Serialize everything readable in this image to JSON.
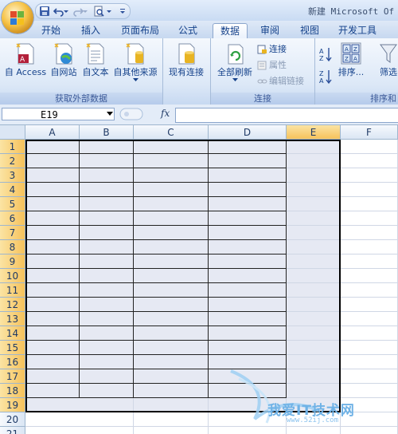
{
  "window": {
    "title": "新建 Microsoft Of",
    "watermark_text": "我爱IT技术网",
    "watermark_url": "www.52ij.com"
  },
  "tabs": [
    {
      "label": "开始",
      "active": false
    },
    {
      "label": "插入",
      "active": false
    },
    {
      "label": "页面布局",
      "active": false
    },
    {
      "label": "公式",
      "active": false
    },
    {
      "label": "数据",
      "active": true
    },
    {
      "label": "审阅",
      "active": false
    },
    {
      "label": "视图",
      "active": false
    },
    {
      "label": "开发工具",
      "active": false
    }
  ],
  "ribbon": {
    "get_external": {
      "label": "获取外部数据",
      "access": "自 Access",
      "web": "自网站",
      "text": "自文本",
      "other": "自其他来源"
    },
    "existing": "现有连接",
    "connections": {
      "label": "连接",
      "refresh_all": "全部刷新",
      "connections": "连接",
      "properties": "属性",
      "edit_links": "编辑链接"
    },
    "sort": {
      "label": "排序和",
      "sort": "排序...",
      "filter": "筛选"
    }
  },
  "formula_bar": {
    "name_box": "E19",
    "fx": "fx",
    "content": ""
  },
  "grid": {
    "columns": [
      "A",
      "B",
      "C",
      "D",
      "E",
      "F"
    ],
    "selected_column": "E",
    "rows": [
      "1",
      "2",
      "3",
      "4",
      "5",
      "6",
      "7",
      "8",
      "9",
      "10",
      "11",
      "12",
      "13",
      "14",
      "15",
      "16",
      "17",
      "18",
      "19",
      "20",
      "21"
    ],
    "selected_rows_until": 19,
    "active_cell": "E19"
  },
  "colors": {
    "ribbon_text": "#15428b",
    "selection_header": "#f6c25b",
    "selection_fill": "#e6e9f3"
  }
}
